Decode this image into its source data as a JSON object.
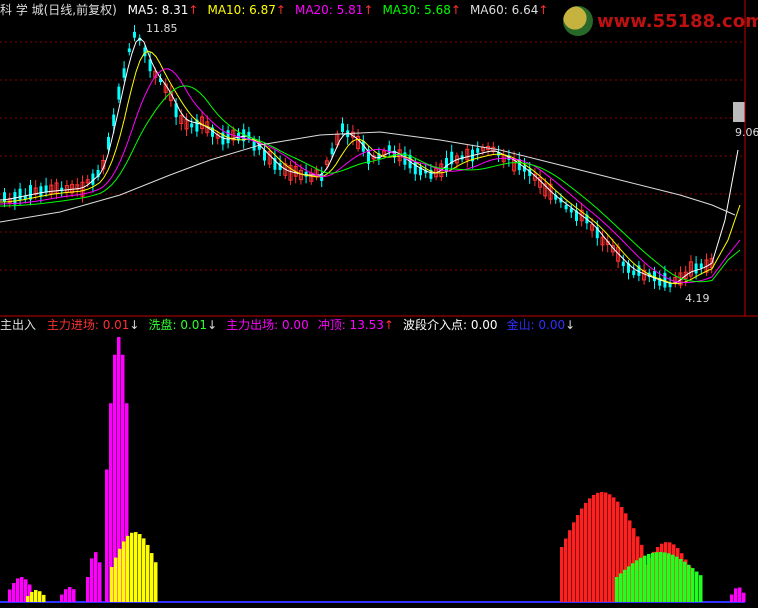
{
  "header": {
    "title": "科 学 城(日线,前复权)",
    "ma_items": [
      {
        "label": "MA5: 8.31",
        "arrow": "↑",
        "color": "#ffffff"
      },
      {
        "label": "MA10: 6.87",
        "arrow": "↑",
        "color": "#ffff00"
      },
      {
        "label": "MA20: 5.81",
        "arrow": "↑",
        "color": "#ff00ff"
      },
      {
        "label": "MA30: 5.68",
        "arrow": "↑",
        "color": "#00ff00"
      },
      {
        "label": "MA60: 6.64",
        "arrow": "↑",
        "color": "#dddddd"
      }
    ]
  },
  "watermark": {
    "site": "www.55188.com"
  },
  "price_labels": {
    "high": "11.85",
    "low": "4.19",
    "last": "9.06"
  },
  "indicator": {
    "name": "主出入",
    "items": [
      {
        "label": "主力进场: 0.01",
        "arrow": "↓",
        "color": "#ff3030"
      },
      {
        "label": "洗盘: 0.01",
        "arrow": "↓",
        "color": "#30ff30"
      },
      {
        "label": "主力出场: 0.00",
        "arrow": "",
        "color": "#ff00ff"
      },
      {
        "label": "冲顶: 13.53",
        "arrow": "↑",
        "color": "#ff00ff"
      },
      {
        "label": "波段介入点: 0.00",
        "arrow": "",
        "color": "#ffffff"
      },
      {
        "label": "金山: 0.00",
        "arrow": "↓",
        "color": "#3030ff"
      }
    ]
  },
  "colors": {
    "up": "#ff3232",
    "down": "#00ffff",
    "grid": "#8b0000",
    "border": "#c00000",
    "ma5": "#ffffff",
    "ma10": "#ffff00",
    "ma20": "#ff00ff",
    "ma30": "#00ff00",
    "ma60": "#dddddd"
  }
}
